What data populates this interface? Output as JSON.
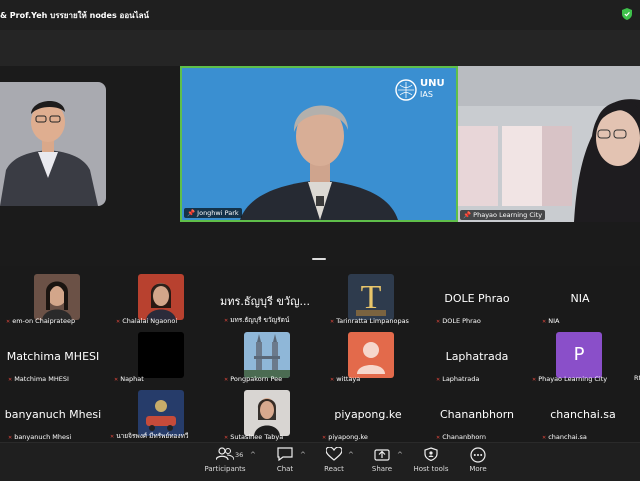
{
  "window": {
    "title": "& Prof.Yeh บรรยายให้ nodes ออนไลน์"
  },
  "speakers": [
    {
      "name": ""
    },
    {
      "name": "Jonghwi Park",
      "logo_main": "UNU",
      "logo_sub": "IAS"
    },
    {
      "name": "Phayao Learning City"
    }
  ],
  "gallery": [
    {
      "display": "",
      "name": "em-on Chaiprateep"
    },
    {
      "display": "",
      "name": "Chalalai Ngaonoi"
    },
    {
      "display": "มทร.ธัญบุรี ขวัญ...",
      "name": "มทร.ธัญบุรี ขวัญรัตน์"
    },
    {
      "display": "",
      "name": "Tarinratta Limpanopas"
    },
    {
      "display": "DOLE Phrao",
      "name": "DOLE Phrao"
    },
    {
      "display": "NIA",
      "name": "NIA"
    },
    {
      "display": "Matchima MHESI",
      "name": "Matchima MHESI"
    },
    {
      "display": "",
      "name": "Naphat"
    },
    {
      "display": "",
      "name": "Pongpakorn Pee"
    },
    {
      "display": "",
      "name": "wittaya"
    },
    {
      "display": "Laphatrada",
      "name": "Laphatrada"
    },
    {
      "display": "",
      "name": "Phayao Learning City",
      "initial": "P"
    },
    {
      "display": "banyanuch Mhesi",
      "name": "banyanuch Mhesi"
    },
    {
      "display": "",
      "name": "นายจิรพงศ์ มีทรัพย์ทองทวี"
    },
    {
      "display": "",
      "name": "Sutasinee Tabya"
    },
    {
      "display": "piyapong.ke",
      "name": "piyapong.ke"
    },
    {
      "display": "Chananbhorn",
      "name": "Chananbhorn"
    },
    {
      "display": "chanchai.sa",
      "name": "chanchai.sa"
    }
  ],
  "gallery_edge": [
    "Rt"
  ],
  "toolbar": {
    "participants_label": "Participants",
    "participants_count": "36",
    "chat_label": "Chat",
    "react_label": "React",
    "share_label": "Share",
    "host_tools_label": "Host tools",
    "more_label": "More"
  },
  "icons": {
    "shield": "shield-icon",
    "participants": "participants-icon",
    "chat": "chat-icon",
    "react": "heart-icon",
    "share": "share-icon",
    "host_tools": "host-shield-icon",
    "more": "more-icon"
  },
  "colors": {
    "active_border": "#5fbf4a",
    "muted": "#e0463c",
    "unu_blue": "#3a8fd1"
  }
}
